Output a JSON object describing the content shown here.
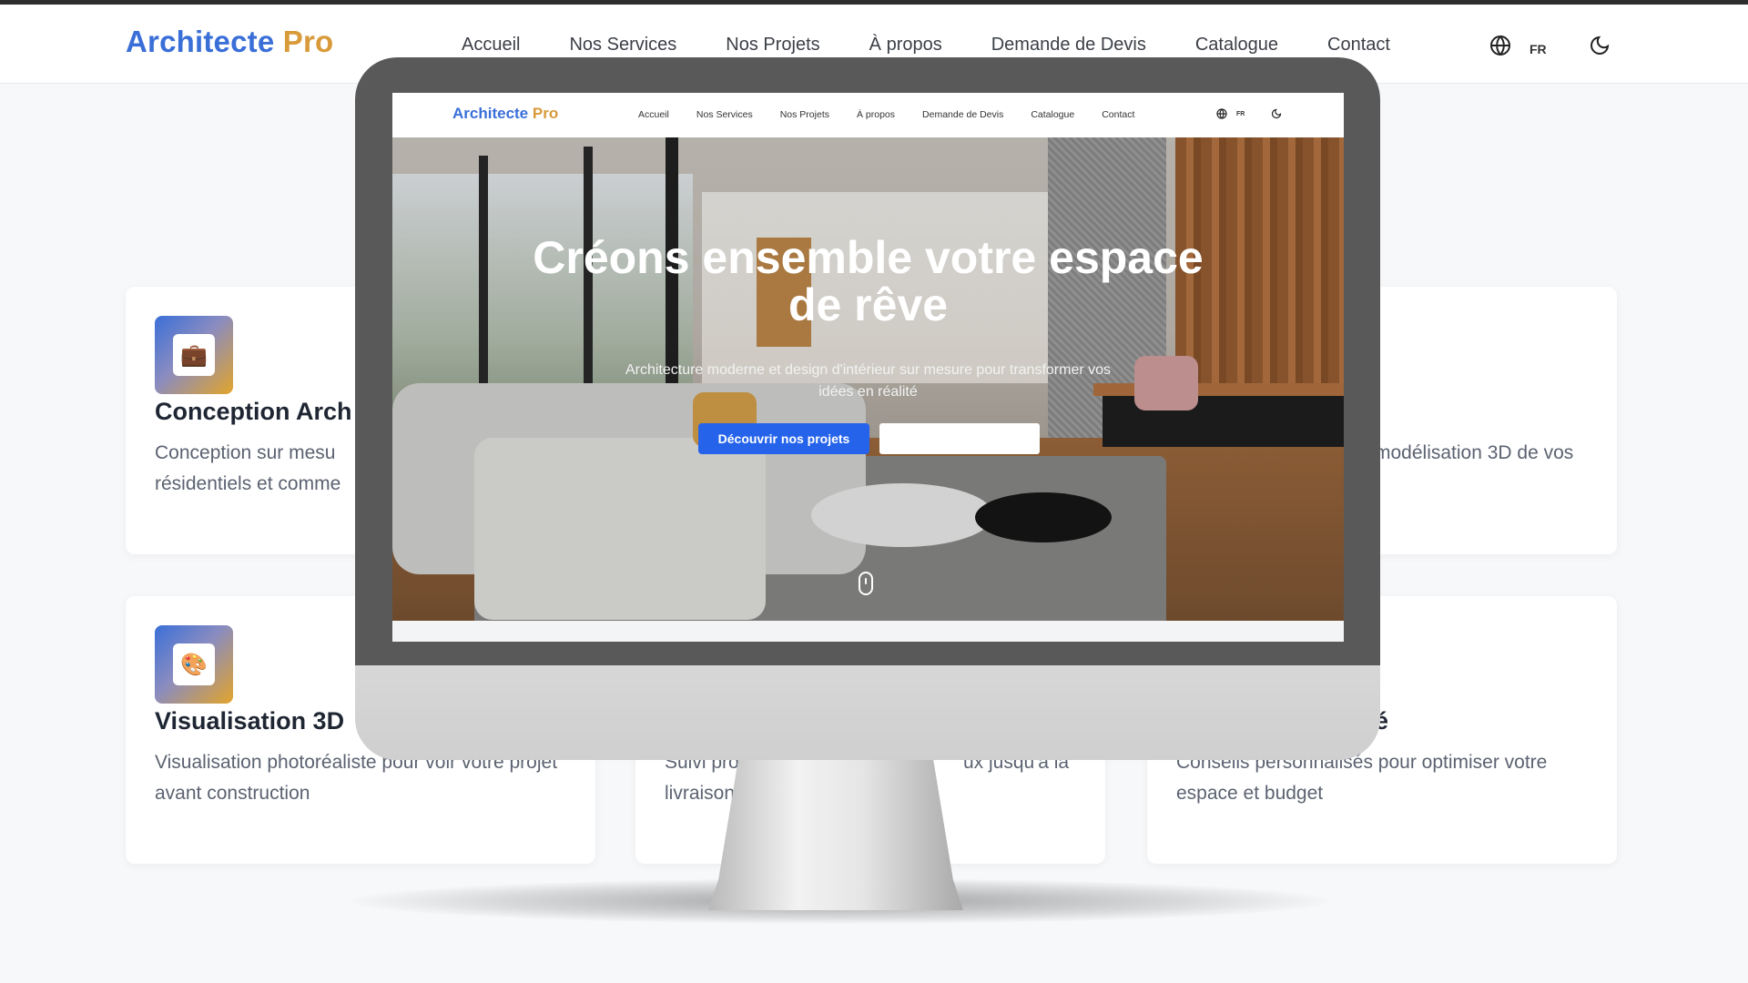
{
  "header": {
    "logo_part1": "Architecte",
    "logo_part2": " Pro",
    "nav": [
      "Accueil",
      "Nos Services",
      "Nos Projets",
      "À propos",
      "Demande de Devis",
      "Catalogue",
      "Contact"
    ],
    "lang": "FR",
    "icons": [
      "globe-icon",
      "moon-icon"
    ]
  },
  "cards": [
    {
      "icon": "briefcase-icon",
      "glyph": "💼",
      "title": "Conception Arch",
      "desc": "Conception sur mesu\nrésidentiels et comme"
    },
    {
      "title_tail": "",
      "desc": "modélisation 3D de vos"
    },
    {
      "icon": "palette-icon",
      "glyph": "🎨",
      "title": "Visualisation 3D",
      "desc": "Visualisation photoréaliste pour voir votre projet avant construction"
    },
    {
      "desc_left": "Suivi prof",
      "desc_right": "ux jusqu'à la",
      "desc_line2": "livraison"
    },
    {
      "title_tail": "alisé",
      "desc": "Conseils personnalisés pour optimiser votre espace et budget"
    }
  ],
  "monitor": {
    "mini_header": {
      "logo_part1": "Architecte",
      "logo_part2": " Pro",
      "nav": [
        "Accueil",
        "Nos Services",
        "Nos Projets",
        "À propos",
        "Demande de Devis",
        "Catalogue",
        "Contact"
      ],
      "lang": "FR"
    },
    "hero": {
      "title": "Créons ensemble votre espace de rêve",
      "subtitle": "Architecture moderne et design d'intérieur sur mesure pour transformer vos idées en réalité",
      "primary_button": "Découvrir nos projets",
      "secondary_button": ""
    }
  },
  "colors": {
    "accent_blue": "#2563eb",
    "logo_blue": "#3a6fd8",
    "logo_gold": "#d89a3a"
  }
}
